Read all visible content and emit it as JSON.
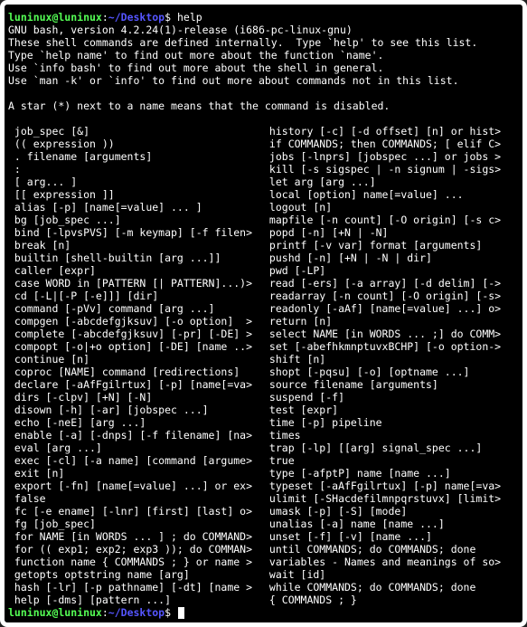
{
  "prompt": {
    "user_host": "luninux@luninux",
    "sep1": ":",
    "path": "~/Desktop",
    "sep2": "$ ",
    "command": "help"
  },
  "header_lines": [
    "GNU bash, version 4.2.24(1)-release (i686-pc-linux-gnu)",
    "These shell commands are defined internally.  Type `help' to see this list.",
    "Type `help name' to find out more about the function `name'.",
    "Use `info bash' to find out more about the shell in general.",
    "Use `man -k' or `info' to find out more about commands not in this list.",
    "",
    "A star (*) next to a name means that the command is disabled.",
    ""
  ],
  "left_col": [
    " job_spec [&]",
    " (( expression ))",
    " . filename [arguments]",
    " :",
    " [ arg... ]",
    " [[ expression ]]",
    " alias [-p] [name[=value] ... ]",
    " bg [job_spec ...]",
    " bind [-lpvsPVS] [-m keymap] [-f filen>",
    " break [n]",
    " builtin [shell-builtin [arg ...]]",
    " caller [expr]",
    " case WORD in [PATTERN [| PATTERN]...)>",
    " cd [-L|[-P [-e]]] [dir]",
    " command [-pVv] command [arg ...]",
    " compgen [-abcdefgjksuv] [-o option]  >",
    " complete [-abcdefgjksuv] [-pr] [-DE] >",
    " compopt [-o|+o option] [-DE] [name ..>",
    " continue [n]",
    " coproc [NAME] command [redirections]",
    " declare [-aAfFgilrtux] [-p] [name[=va>",
    " dirs [-clpv] [+N] [-N]",
    " disown [-h] [-ar] [jobspec ...]",
    " echo [-neE] [arg ...]",
    " enable [-a] [-dnps] [-f filename] [na>",
    " eval [arg ...]",
    " exec [-cl] [-a name] [command [argume>",
    " exit [n]",
    " export [-fn] [name[=value] ...] or ex>",
    " false",
    " fc [-e ename] [-lnr] [first] [last] o>",
    " fg [job_spec]",
    " for NAME [in WORDS ... ] ; do COMMAND>",
    " for (( exp1; exp2; exp3 )); do COMMAN>",
    " function name { COMMANDS ; } or name >",
    " getopts optstring name [arg]",
    " hash [-lr] [-p pathname] [-dt] [name >",
    " help [-dms] [pattern ...]"
  ],
  "right_col": [
    " history [-c] [-d offset] [n] or hist>",
    " if COMMANDS; then COMMANDS; [ elif C>",
    " jobs [-lnprs] [jobspec ...] or jobs >",
    " kill [-s sigspec | -n signum | -sigs>",
    " let arg [arg ...]",
    " local [option] name[=value] ...",
    " logout [n]",
    " mapfile [-n count] [-O origin] [-s c>",
    " popd [-n] [+N | -N]",
    " printf [-v var] format [arguments]",
    " pushd [-n] [+N | -N | dir]",
    " pwd [-LP]",
    " read [-ers] [-a array] [-d delim] [->",
    " readarray [-n count] [-O origin] [-s>",
    " readonly [-aAf] [name[=value] ...] o>",
    " return [n]",
    " select NAME [in WORDS ... ;] do COMM>",
    " set [-abefhkmnptuvxBCHP] [-o option->",
    " shift [n]",
    " shopt [-pqsu] [-o] [optname ...]",
    " source filename [arguments]",
    " suspend [-f]",
    " test [expr]",
    " time [-p] pipeline",
    " times",
    " trap [-lp] [[arg] signal_spec ...]",
    " true",
    " type [-afptP] name [name ...]",
    " typeset [-aAfFgilrtux] [-p] name[=va>",
    " ulimit [-SHacdefilmnpqrstuvx] [limit>",
    " umask [-p] [-S] [mode]",
    " unalias [-a] name [name ...]",
    " unset [-f] [-v] [name ...]",
    " until COMMANDS; do COMMANDS; done",
    " variables - Names and meanings of so>",
    " wait [id]",
    " while COMMANDS; do COMMANDS; done",
    " { COMMANDS ; }"
  ],
  "prompt2": {
    "user_host": "luninux@luninux",
    "sep1": ":",
    "path": "~/Desktop",
    "sep2": "$ "
  }
}
